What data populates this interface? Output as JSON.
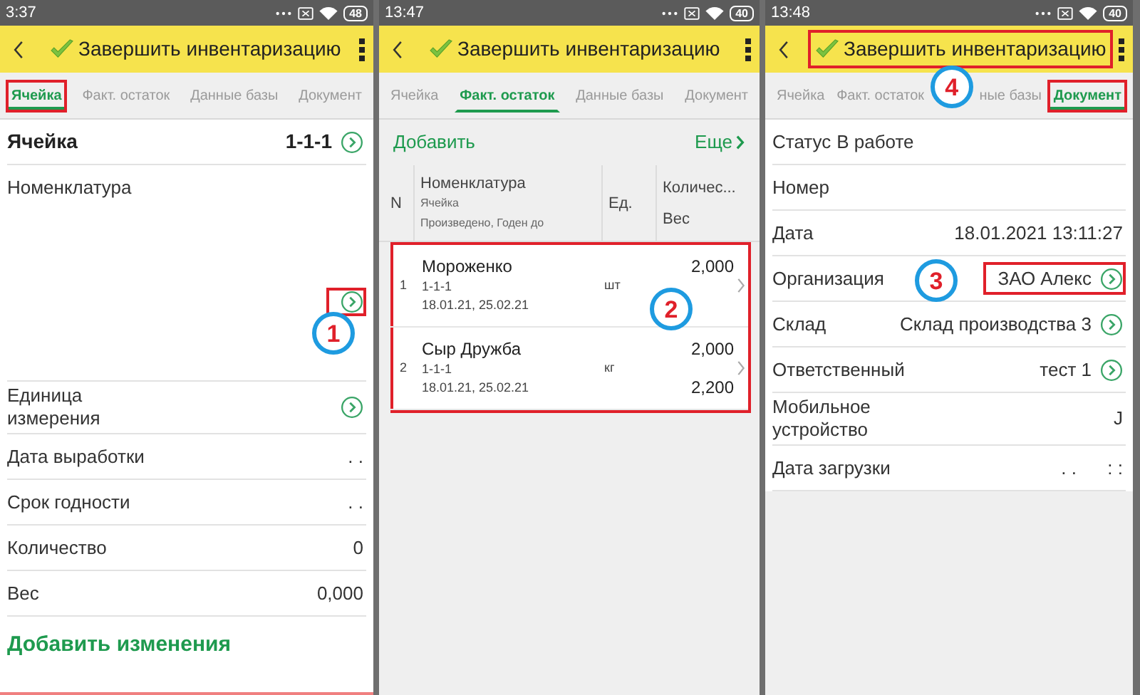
{
  "screens": [
    {
      "kind": "form",
      "status_bar": {
        "time": "3:37",
        "battery": "48"
      },
      "header": {
        "title": "Завершить инвентаризацию",
        "highlighted": false
      },
      "tabs": [
        {
          "label": "Ячейка",
          "selected": true,
          "highlighted": true
        },
        {
          "label": "Факт. остаток",
          "selected": false,
          "highlighted": false
        },
        {
          "label": "Данные базы",
          "selected": false,
          "highlighted": false
        },
        {
          "label": "Документ",
          "selected": false,
          "highlighted": false
        }
      ],
      "fields": [
        {
          "kind": "bold",
          "label": "Ячейка",
          "value": "1-1-1",
          "link": true,
          "highlighted": false
        },
        {
          "kind": "tall",
          "label": "Номенклатура",
          "link": true,
          "highlighted": true,
          "callout": "1"
        },
        {
          "kind": "normal",
          "label": "Единица измерения",
          "link": true,
          "highlighted": false
        },
        {
          "kind": "normal",
          "label": "Дата выработки",
          "value": ". .",
          "link": false,
          "highlighted": false
        },
        {
          "kind": "normal",
          "label": "Срок годности",
          "value": ". .",
          "link": false,
          "highlighted": false
        },
        {
          "kind": "normal",
          "label": "Количество",
          "value": "0",
          "link": false,
          "highlighted": false
        },
        {
          "kind": "normal",
          "label": "Вес",
          "value": "0,000",
          "link": false,
          "highlighted": false
        }
      ],
      "action": "Добавить изменения"
    },
    {
      "kind": "table",
      "status_bar": {
        "time": "13:47",
        "battery": "40"
      },
      "header": {
        "title": "Завершить инвентаризацию",
        "highlighted": false
      },
      "tabs": [
        {
          "label": "Ячейка",
          "selected": false,
          "highlighted": false
        },
        {
          "label": "Факт. остаток",
          "selected": true,
          "highlighted": false
        },
        {
          "label": "Данные базы",
          "selected": false,
          "highlighted": false
        },
        {
          "label": "Документ",
          "selected": false,
          "highlighted": false
        }
      ],
      "toolbar": {
        "add": "Добавить",
        "more": "Еще"
      },
      "columns": [
        {
          "lines": [
            "N"
          ]
        },
        {
          "lines": [
            "Номенклатура",
            "Ячейка",
            "Произведено, Годен до"
          ]
        },
        {
          "lines": [
            "Ед."
          ]
        },
        {
          "lines": [
            "Количес...",
            "Вес"
          ]
        }
      ],
      "rows_highlighted": true,
      "rows_callout": "2",
      "rows": [
        {
          "n": "1",
          "name": "Мороженко",
          "cell": "1-1-1",
          "dates": "18.01.21, 25.02.21",
          "unit": "шт",
          "quantity": "2,000"
        },
        {
          "n": "2",
          "name": "Сыр Дружба",
          "cell": "1-1-1",
          "dates": "18.01.21, 25.02.21",
          "unit": "кг",
          "quantity": "2,000",
          "weight": "2,200"
        }
      ]
    },
    {
      "kind": "form",
      "status_bar": {
        "time": "13:48",
        "battery": "40"
      },
      "header": {
        "title": "Завершить инвентаризацию",
        "highlighted": true,
        "callout": "4"
      },
      "tabs": [
        {
          "label": "Ячейка",
          "selected": false,
          "highlighted": false
        },
        {
          "label": "Факт. остаток",
          "selected": false,
          "highlighted": false
        },
        {
          "label": "ные базы",
          "selected": false,
          "highlighted": false
        },
        {
          "label": "Документ",
          "selected": true,
          "highlighted": true
        }
      ],
      "fields": [
        {
          "kind": "inline",
          "label": "Статус",
          "value": "В работе",
          "link": false,
          "highlighted": false
        },
        {
          "kind": "normal",
          "label": "Номер",
          "link": false,
          "highlighted": false
        },
        {
          "kind": "normal",
          "label": "Дата",
          "value": "18.01.2021 13:11:27",
          "link": false,
          "highlighted": false
        },
        {
          "kind": "normal",
          "label": "Организация",
          "value": "ЗАО Алекс",
          "link": true,
          "highlighted": true,
          "callout": "3"
        },
        {
          "kind": "normal",
          "label": "Склад",
          "value": "Склад производства 3",
          "link": true,
          "highlighted": false
        },
        {
          "kind": "normal",
          "label": "Ответственный",
          "value": "тест 1",
          "link": true,
          "highlighted": false
        },
        {
          "kind": "normal",
          "label": "Мобильное устройство",
          "value": "J",
          "link": false,
          "highlighted": false
        },
        {
          "kind": "normal",
          "label": "Дата загрузки",
          "value": ". .      : :",
          "link": false,
          "highlighted": false
        }
      ]
    }
  ]
}
